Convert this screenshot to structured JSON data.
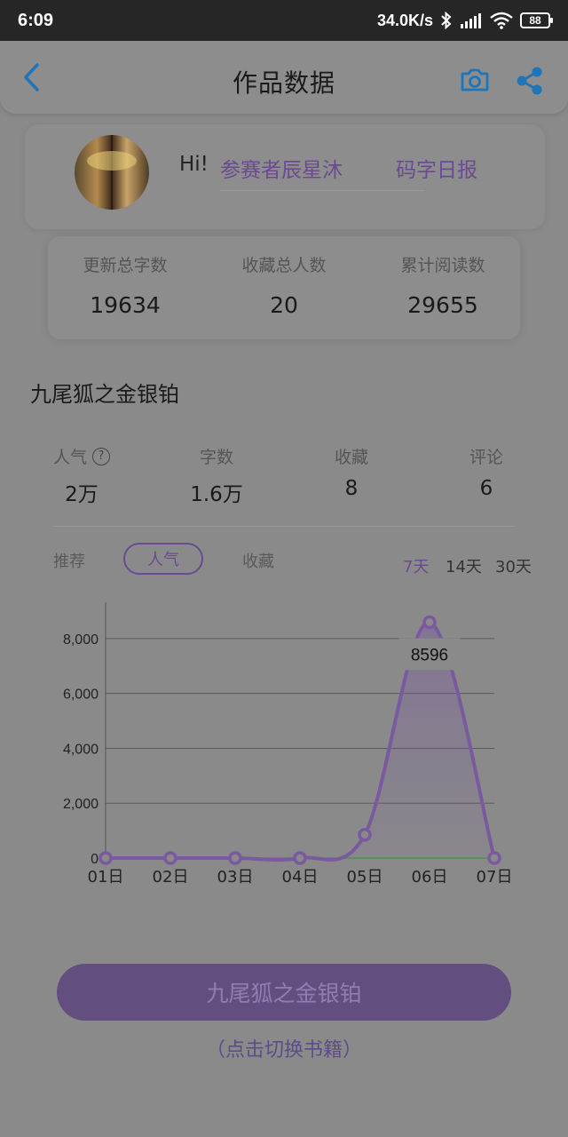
{
  "status_bar": {
    "time": "6:09",
    "network_speed": "34.0K/s",
    "battery": "88"
  },
  "header": {
    "title": "作品数据",
    "back_icon": "chevron-left-icon",
    "camera_icon": "camera-icon",
    "share_icon": "share-icon",
    "accent": "#1f75b8"
  },
  "profile": {
    "greeting": "Hi!",
    "username": "参赛者辰星沐",
    "daily_report": "码字日报",
    "accent": "#6a4a91"
  },
  "stats": [
    {
      "label": "更新总字数",
      "value": "19634"
    },
    {
      "label": "收藏总人数",
      "value": "20"
    },
    {
      "label": "累计阅读数",
      "value": "29655"
    }
  ],
  "book": {
    "title": "九尾狐之金银铂",
    "metrics": [
      {
        "label": "人气",
        "value": "2万"
      },
      {
        "label": "字数",
        "value": "1.6万"
      },
      {
        "label": "收藏",
        "value": "8"
      },
      {
        "label": "评论",
        "value": "6"
      }
    ]
  },
  "chart_tabs": {
    "items": [
      "推荐",
      "人气",
      "收藏"
    ],
    "active": "人气"
  },
  "time_ranges": {
    "items": [
      "7天",
      "14天",
      "30天"
    ],
    "active": "7天"
  },
  "chart_data": {
    "type": "area",
    "x": [
      "01日",
      "02日",
      "03日",
      "04日",
      "05日",
      "06日",
      "07日"
    ],
    "series": [
      {
        "values": [
          0,
          0,
          0,
          0,
          850,
          8596,
          0
        ],
        "color": "#7a5a9e"
      }
    ],
    "ylim": [
      0,
      9000
    ],
    "yticks": [
      0,
      2000,
      4000,
      6000,
      8000
    ],
    "ytick_labels": [
      "0",
      "2,000",
      "4,000",
      "6,000",
      "8,000"
    ],
    "highlight": {
      "index": 5,
      "label": "8596"
    },
    "grid": true
  },
  "bottom": {
    "button_label": "九尾狐之金银铂",
    "switch_hint": "（点击切换书籍）"
  }
}
